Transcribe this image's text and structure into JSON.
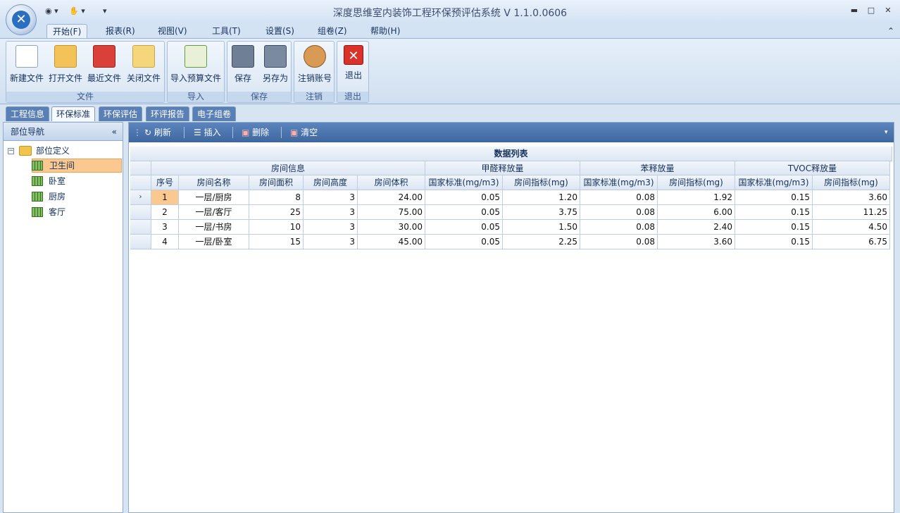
{
  "window": {
    "title": "深度思维室内装饰工程环保预评估系统  V 1.1.0.0606",
    "min": "▬",
    "max": "□",
    "close": "✕"
  },
  "menu": [
    "开始(F)",
    "报表(R)",
    "视图(V)",
    "工具(T)",
    "设置(S)",
    "组卷(Z)",
    "帮助(H)"
  ],
  "ribbon": {
    "groups": {
      "file": "文件",
      "import": "导入",
      "save": "保存",
      "logout": "注销",
      "exit": "退出"
    },
    "buttons": {
      "new": "新建文件",
      "open": "打开文件",
      "recent": "最近文件",
      "close": "关闭文件",
      "import": "导入预算文件",
      "save": "保存",
      "saveas": "另存为",
      "logout": "注销账号",
      "exit": "退出"
    }
  },
  "tabs": [
    "工程信息",
    "环保标准",
    "环保评估",
    "环评报告",
    "电子组卷"
  ],
  "nav": {
    "title": "部位导航",
    "collapse": "«",
    "root": "部位定义",
    "items": [
      "卫生间",
      "卧室",
      "厨房",
      "客厅"
    ],
    "selected": "卫生间"
  },
  "toolbar": {
    "refresh": "刷新",
    "insert": "插入",
    "delete": "删除",
    "clear": "清空"
  },
  "grid": {
    "caption": "数据列表",
    "groups": {
      "room": "房间信息",
      "formaldehyde": "甲醛释放量",
      "benzene": "苯释放量",
      "tvoc": "TVOC释放量"
    },
    "columns": [
      "序号",
      "房间名称",
      "房间面积",
      "房间高度",
      "房间体积",
      "国家标准(mg/m3)",
      "房间指标(mg)",
      "国家标准(mg/m3)",
      "房间指标(mg)",
      "国家标准(mg/m3)",
      "房间指标(mg)"
    ],
    "rows": [
      [
        "1",
        "一层/厨房",
        "8",
        "3",
        "24.00",
        "0.05",
        "1.20",
        "0.08",
        "1.92",
        "0.15",
        "3.60"
      ],
      [
        "2",
        "一层/客厅",
        "25",
        "3",
        "75.00",
        "0.05",
        "3.75",
        "0.08",
        "6.00",
        "0.15",
        "11.25"
      ],
      [
        "3",
        "一层/书房",
        "10",
        "3",
        "30.00",
        "0.05",
        "1.50",
        "0.08",
        "2.40",
        "0.15",
        "4.50"
      ],
      [
        "4",
        "一层/卧室",
        "15",
        "3",
        "45.00",
        "0.05",
        "2.25",
        "0.08",
        "3.60",
        "0.15",
        "6.75"
      ]
    ]
  }
}
